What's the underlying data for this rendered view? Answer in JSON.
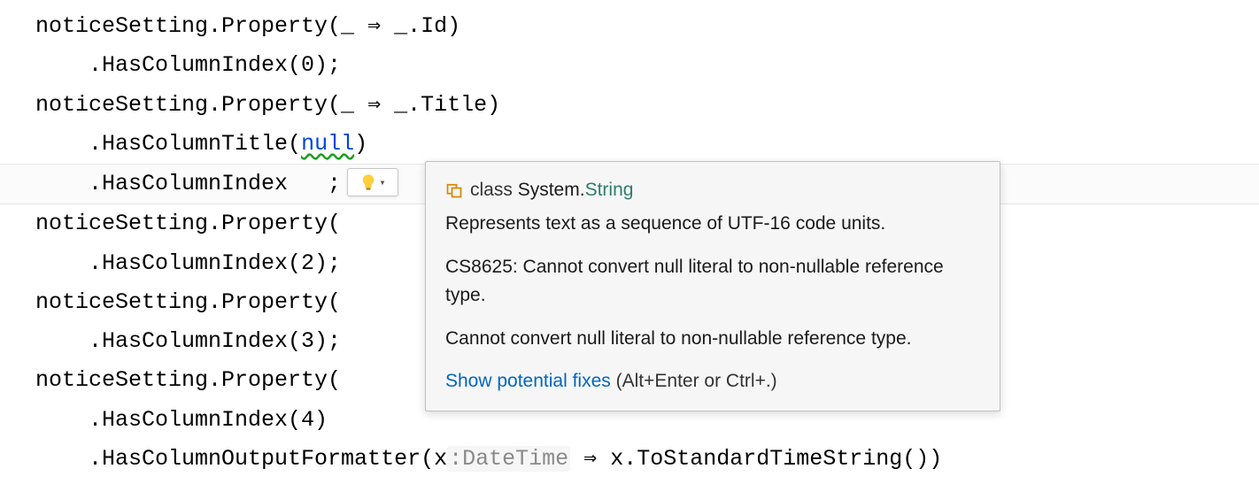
{
  "code": {
    "l1a": "noticeSetting.Property(_ ",
    "arrow": "⇒",
    "l1b": " _.Id)",
    "l2": "    .HasColumnIndex(0);",
    "l3a": "noticeSetting.Property(_ ",
    "l3b": " _.Title)",
    "l4a": "    .HasColumnTitle(",
    "l4_null": "null",
    "l4b": ")",
    "l5": "    .HasColumnIndex   ;",
    "l6": "noticeSetting.Property(",
    "l7": "    .HasColumnIndex(2);",
    "l8": "noticeSetting.Property(",
    "l9": "    .HasColumnIndex(3);",
    "l10": "noticeSetting.Property(",
    "l11": "    .HasColumnIndex(4)",
    "l12a": "    .HasColumnOutputFormatter(x",
    "l12_hint": ":DateTime",
    "l12b": " ",
    "l12c": " x.ToStandardTimeString())"
  },
  "tooltip": {
    "class_keyword": "class",
    "namespace": "System.",
    "type": "String",
    "description": "Represents text as a sequence of UTF-16 code units.",
    "error": "CS8625: Cannot convert null literal to non-nullable reference type.",
    "error2": "Cannot convert null literal to non-nullable reference type.",
    "fixes_link": "Show potential fixes",
    "fixes_hint": " (Alt+Enter or Ctrl+.)"
  }
}
